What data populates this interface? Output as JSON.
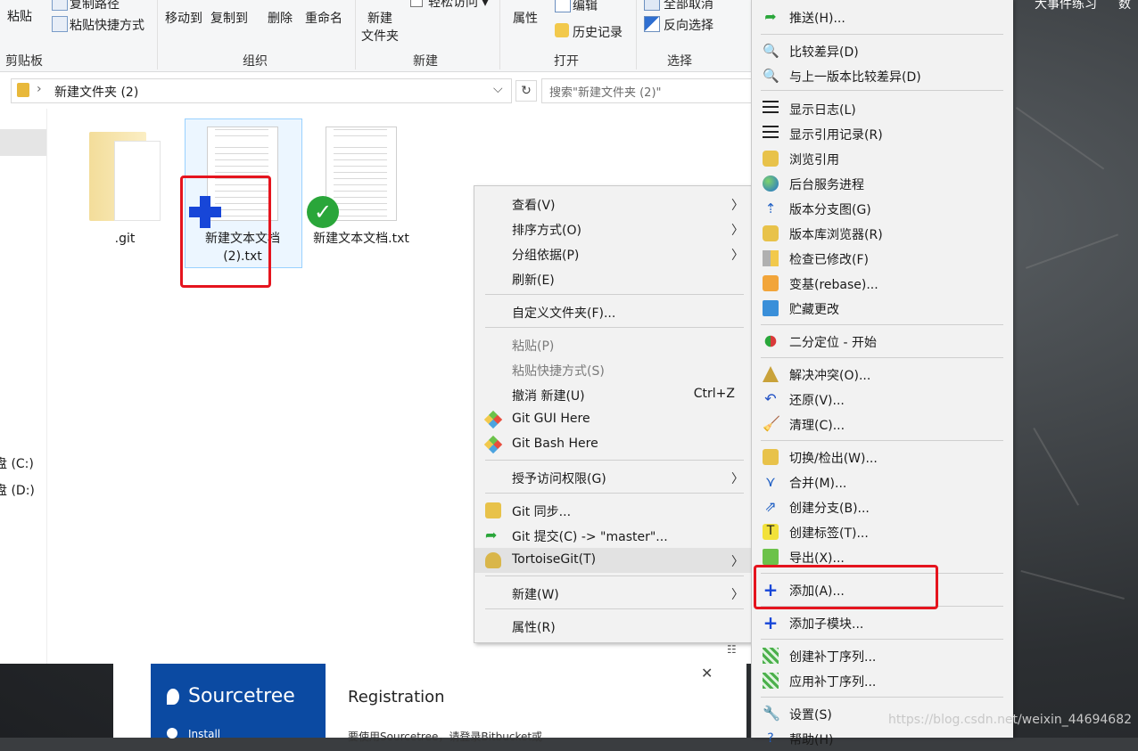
{
  "ribbon": {
    "paste": "粘贴",
    "copy_path": "复制路径",
    "paste_shortcut": "粘贴快捷方式",
    "move_to": "移动到",
    "copy_to": "复制到",
    "delete": "删除",
    "rename": "重命名",
    "new_folder_line1": "新建",
    "new_folder_line2": "文件夹",
    "easy_access": "轻松访问 ▾",
    "properties": "属性",
    "edit": "编辑",
    "history": "历史记录",
    "select_none": "全部取消",
    "invert_select": "反向选择",
    "groups": [
      "剪贴板",
      "组织",
      "新建",
      "打开",
      "选择"
    ]
  },
  "address": {
    "path": "新建文件夹 (2)",
    "search_placeholder": "搜索\"新建文件夹 (2)\""
  },
  "nav": {
    "drive_c": "盘 (C:)",
    "drive_d": "盘 (D:)"
  },
  "files": [
    {
      "name": ".git"
    },
    {
      "name": "新建文本文档 (2).txt"
    },
    {
      "name": "新建文本文档.txt"
    }
  ],
  "context_menu": {
    "items": [
      {
        "label": "查看(V)",
        "submenu": true
      },
      {
        "label": "排序方式(O)",
        "submenu": true
      },
      {
        "label": "分组依据(P)",
        "submenu": true
      },
      {
        "label": "刷新(E)"
      },
      {
        "label": "自定义文件夹(F)..."
      },
      {
        "label": "粘贴(P)",
        "disabled": true
      },
      {
        "label": "粘贴快捷方式(S)",
        "disabled": true
      },
      {
        "label": "撤消 新建(U)",
        "shortcut": "Ctrl+Z"
      },
      {
        "label": "Git GUI Here"
      },
      {
        "label": "Git Bash Here"
      },
      {
        "label": "授予访问权限(G)",
        "submenu": true
      },
      {
        "label": "Git 同步..."
      },
      {
        "label": "Git 提交(C) -> \"master\"..."
      },
      {
        "label": "TortoiseGit(T)",
        "submenu": true
      },
      {
        "label": "新建(W)",
        "submenu": true
      },
      {
        "label": "属性(R)"
      }
    ]
  },
  "tortoise_menu": {
    "items": [
      {
        "label": "推送(H)...",
        "icon": "push-icon"
      },
      {
        "label": "比较差异(D)",
        "icon": "magnifier-icon"
      },
      {
        "label": "与上一版本比较差异(D)",
        "icon": "magnifier-icon"
      },
      {
        "label": "显示日志(L)",
        "icon": "log-icon"
      },
      {
        "label": "显示引用记录(R)",
        "icon": "log-icon"
      },
      {
        "label": "浏览引用",
        "icon": "lock-icon"
      },
      {
        "label": "后台服务进程",
        "icon": "globe-icon"
      },
      {
        "label": "版本分支图(G)",
        "icon": "branch-graph-icon"
      },
      {
        "label": "版本库浏览器(R)",
        "icon": "repo-browser-icon"
      },
      {
        "label": "检查已修改(F)",
        "icon": "check-modifications-icon"
      },
      {
        "label": "变基(rebase)...",
        "icon": "rebase-icon"
      },
      {
        "label": "贮藏更改",
        "icon": "stash-icon"
      },
      {
        "label": "二分定位 - 开始",
        "icon": "bisect-icon"
      },
      {
        "label": "解决冲突(O)...",
        "icon": "resolve-icon"
      },
      {
        "label": "还原(V)...",
        "icon": "revert-icon"
      },
      {
        "label": "清理(C)...",
        "icon": "broom-icon"
      },
      {
        "label": "切换/检出(W)...",
        "icon": "switch-icon"
      },
      {
        "label": "合并(M)...",
        "icon": "merge-icon"
      },
      {
        "label": "创建分支(B)...",
        "icon": "create-branch-icon"
      },
      {
        "label": "创建标签(T)...",
        "icon": "tag-icon"
      },
      {
        "label": "导出(X)...",
        "icon": "export-icon"
      },
      {
        "label": "添加(A)...",
        "icon": "plus-icon"
      },
      {
        "label": "添加子模块...",
        "icon": "plus-icon"
      },
      {
        "label": "创建补丁序列...",
        "icon": "patch-icon"
      },
      {
        "label": "应用补丁序列...",
        "icon": "patch-icon"
      },
      {
        "label": "设置(S)",
        "icon": "wrench-icon"
      },
      {
        "label": "帮助(H)",
        "icon": "help-icon"
      }
    ]
  },
  "desktop": {
    "top_text_1": "大事件练习",
    "top_text_2": "数"
  },
  "sourcetree": {
    "brand": "Sourcetree",
    "install": "Install",
    "registration": "Registration",
    "note": "要使用Sourcetree，请登录Bitbucket或"
  },
  "watermark": "https://blog.csdn.net/weixin_44694682",
  "colors": {
    "highlight_red": "#e5141e",
    "sourcetree_blue": "#0b4aa2",
    "plus_blue": "#1746d8",
    "check_green": "#2aa63a"
  }
}
